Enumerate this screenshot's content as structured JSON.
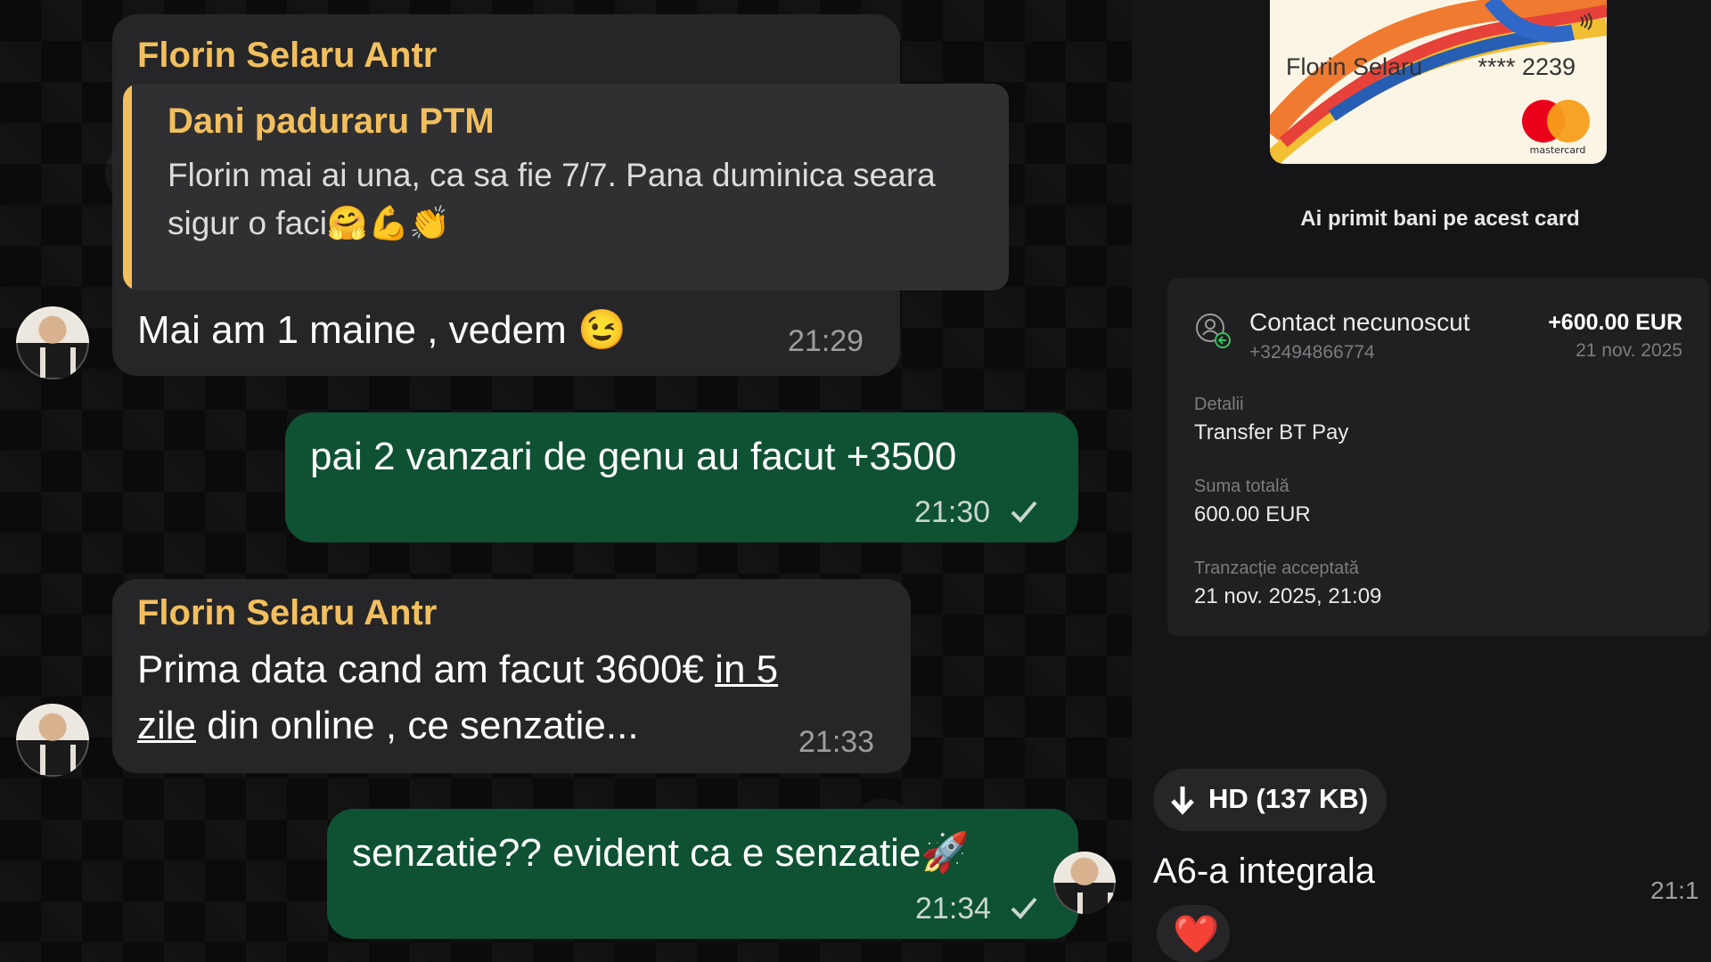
{
  "messages": [
    {
      "sender": "Florin Selaru Antr",
      "quote_sender": "Dani paduraru PTM",
      "quote_text": "Florin mai ai una, ca sa fie 7/7. Pana duminica seara sigur o faci🤗💪👏",
      "text": "Mai am 1 maine , vedem 😉",
      "time": "21:29"
    },
    {
      "text": "pai 2 vanzari de genu au facut +3500",
      "time": "21:30"
    },
    {
      "sender": "Florin Selaru Antr",
      "text_line1_plain": "Prima data cand am facut 3600€ ",
      "text_line1_underlined": "in 5",
      "text_line2_underlined": "zile",
      "text_line2_plain": " din online , ce senzatie...",
      "time": "21:33"
    },
    {
      "text": "senzatie?? evident ca e senzatie🚀",
      "time": "21:34"
    }
  ],
  "right_panel": {
    "card": {
      "name": "Florin Selaru",
      "number": "**** 2239",
      "brand": "mastercard"
    },
    "received_label": "Ai primit bani pe acest card",
    "transaction": {
      "contact": "Contact necunoscut",
      "phone": "+32494866774",
      "amount": "+600.00 EUR",
      "date": "21 nov. 2025",
      "details_label": "Detalii",
      "details_value": "Transfer BT Pay",
      "total_label": "Suma totală",
      "total_value": "600.00 EUR",
      "status_label": "Tranzacție acceptată",
      "status_value": "21 nov. 2025, 21:09"
    },
    "hd_button_label": "HD (137 KB)",
    "message_text": "A6-a integrala",
    "message_time": "21:1",
    "reaction": "❤️"
  },
  "icons": [
    "avatar",
    "check-icon",
    "contact-icon",
    "contactless-icon",
    "download-icon",
    "heart-icon"
  ],
  "colors": {
    "incoming_bubble": "#262628",
    "outgoing_bubble": "#0f5133",
    "sender_name": "#f2bf5e",
    "timestamp": "#9e9ea1"
  }
}
